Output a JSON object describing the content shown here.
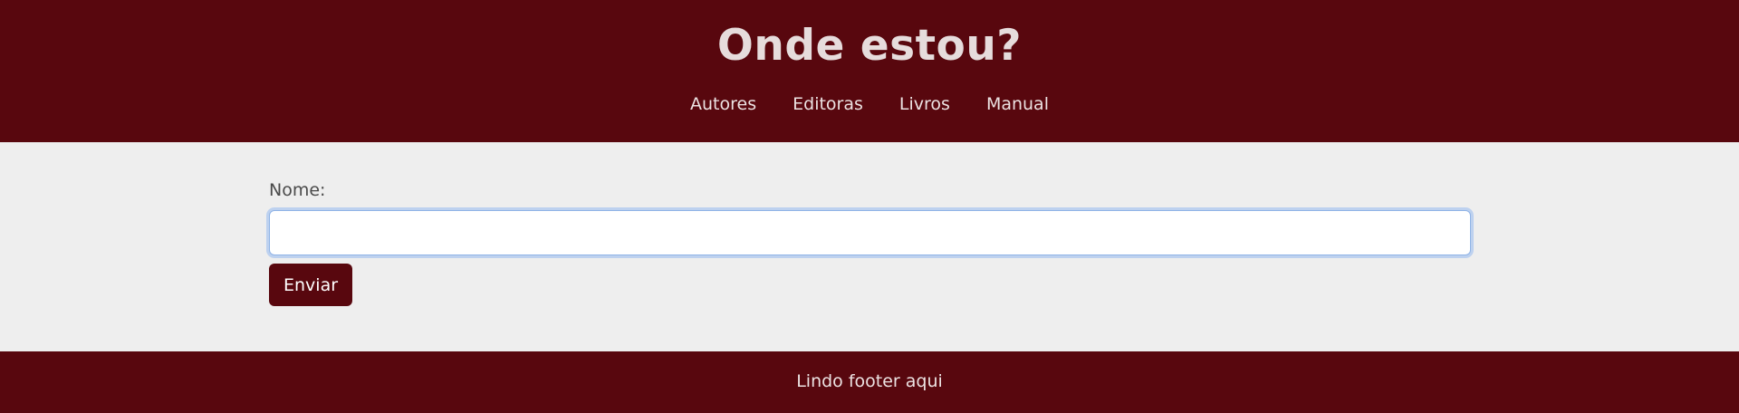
{
  "header": {
    "title": "Onde estou?",
    "nav": [
      {
        "label": "Autores"
      },
      {
        "label": "Editoras"
      },
      {
        "label": "Livros"
      },
      {
        "label": "Manual"
      }
    ]
  },
  "form": {
    "name_label": "Nome:",
    "name_value": "",
    "submit_label": "Enviar"
  },
  "footer": {
    "text": "Lindo footer aqui"
  },
  "colors": {
    "brand": "#58070e",
    "page_background": "#eeeeee",
    "focus_ring": "#96b9f0"
  }
}
